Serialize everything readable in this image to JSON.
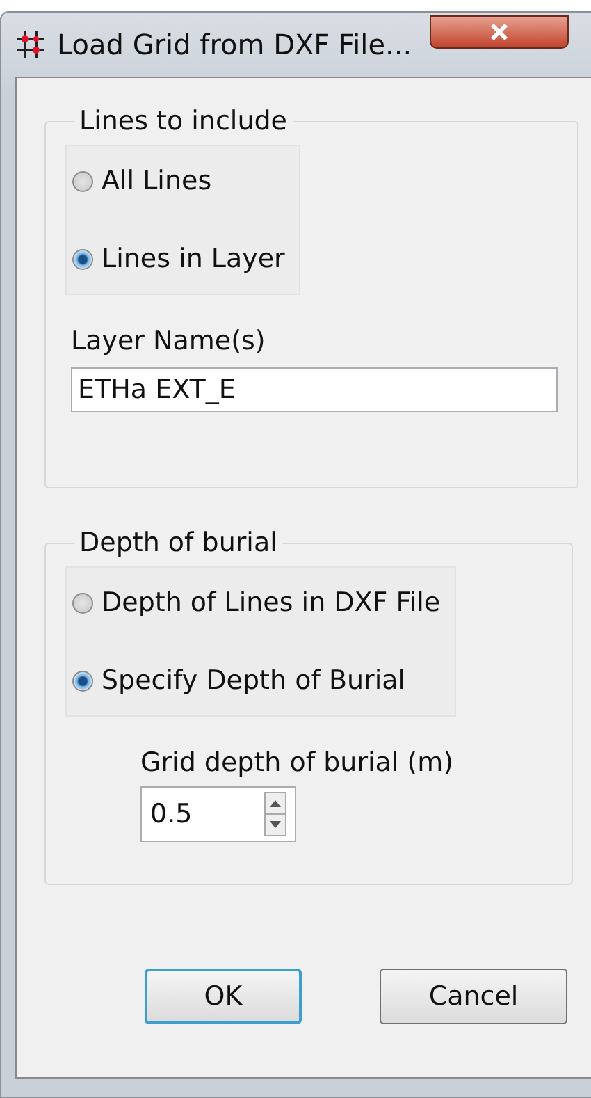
{
  "window": {
    "title": "Load Grid from DXF File..."
  },
  "lines_group": {
    "title": "Lines to include",
    "options": [
      {
        "label": "All Lines",
        "selected": false
      },
      {
        "label": "Lines in Layer",
        "selected": true
      }
    ],
    "layer_label": "Layer Name(s)",
    "layer_value": "ETHa EXT_E"
  },
  "depth_group": {
    "title": "Depth of burial",
    "options": [
      {
        "label": "Depth of Lines in DXF File",
        "selected": false
      },
      {
        "label": "Specify Depth of Burial",
        "selected": true
      }
    ],
    "depth_label": "Grid depth of burial (m)",
    "depth_value": "0.5"
  },
  "buttons": [
    {
      "label": "OK",
      "default": true
    },
    {
      "label": "Cancel",
      "default": false
    }
  ]
}
